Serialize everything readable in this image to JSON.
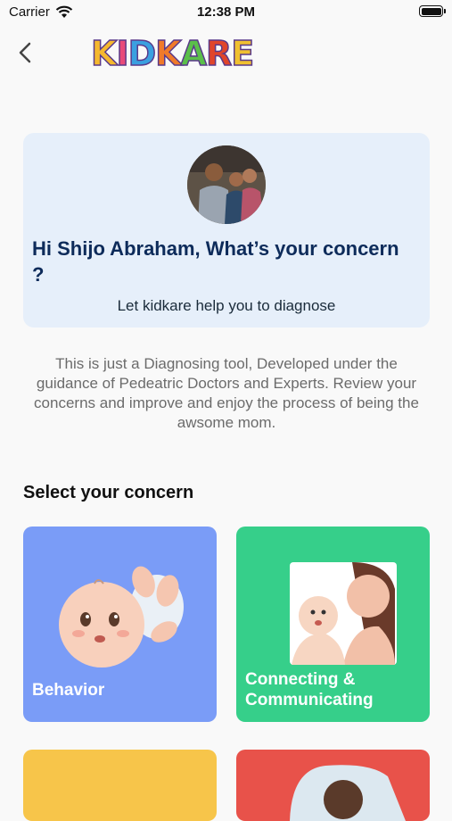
{
  "status_bar": {
    "carrier": "Carrier",
    "time": "12:38 PM"
  },
  "header": {
    "logo_letters": [
      {
        "char": "K",
        "color": "#f5b82e"
      },
      {
        "char": "I",
        "color": "#e84a7a"
      },
      {
        "char": "D",
        "color": "#3aa0e0"
      },
      {
        "char": "K",
        "color": "#f07a2a"
      },
      {
        "char": "A",
        "color": "#5bbf4a"
      },
      {
        "char": "R",
        "color": "#e0452a"
      },
      {
        "char": "E",
        "color": "#f0c030"
      }
    ]
  },
  "profile_card": {
    "greeting": "Hi Shijo Abraham, What’s your concern ?",
    "helper_text": "Let kidkare help you to diagnose"
  },
  "disclaimer": "This is just a Diagnosing tool, Developed under the guidance of Pedeatric Doctors and Experts. Review your concerns and improve and enjoy the process of being the awsome mom.",
  "concerns": {
    "section_title": "Select your concern",
    "items": [
      {
        "label": "Behavior",
        "color": "#7a9cf7"
      },
      {
        "label": "Connecting & Communicating",
        "color": "#36cf8a"
      },
      {
        "label": "",
        "color": "#f7c54a"
      },
      {
        "label": "",
        "color": "#e8524a"
      }
    ]
  }
}
